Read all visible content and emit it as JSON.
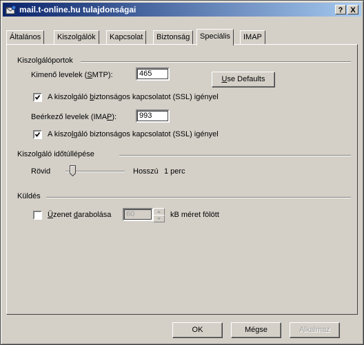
{
  "window": {
    "title": "mail.t-online.hu tulajdonságai",
    "help_button": "?",
    "close_button": "X"
  },
  "tabs": [
    {
      "label": "Általános",
      "active": false
    },
    {
      "label": "Kiszolgálók",
      "active": false
    },
    {
      "label": "Kapcsolat",
      "active": false
    },
    {
      "label": "Biztonság",
      "active": false
    },
    {
      "label": "Speciális",
      "active": true
    },
    {
      "label": "IMAP",
      "active": false
    }
  ],
  "server_ports": {
    "group_label": "Kiszolgálóportok",
    "smtp_label": "Kimenő levelek (SMTP):",
    "smtp_value": "465",
    "use_defaults_label": "Use Defaults",
    "smtp_ssl_label": "A kiszolgáló biztonságos kapcsolatot (SSL) igényel",
    "smtp_ssl_checked": true,
    "imap_label": "Beérkező levelek (IMAP):",
    "imap_value": "993",
    "imap_ssl_label": "A kiszolgáló biztonságos kapcsolatot (SSL) igényel",
    "imap_ssl_checked": true
  },
  "timeout": {
    "group_label": "Kiszolgáló időtúllépése",
    "short_label": "Rövid",
    "long_label": "Hosszú",
    "value_text": "1 perc",
    "slider_fraction": 0.12
  },
  "sending": {
    "group_label": "Küldés",
    "split_label": "Üzenet darabolása",
    "split_checked": false,
    "split_size_value": "60",
    "size_suffix": "kB méret fölött"
  },
  "footer": {
    "ok_label": "OK",
    "cancel_label": "Mégse",
    "apply_label": "Alkalmaz"
  },
  "colors": {
    "titlebar_start": "#0a246a",
    "titlebar_end": "#a6caf0",
    "dialog_face": "#d4d0c8"
  }
}
